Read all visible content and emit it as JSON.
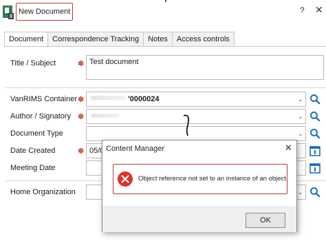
{
  "window": {
    "title": "New Document",
    "help_label": "?",
    "close_label": "✕"
  },
  "tabs": [
    {
      "label": "Document"
    },
    {
      "label": "Correspondence Tracking"
    },
    {
      "label": "Notes"
    },
    {
      "label": "Access controls"
    }
  ],
  "form": {
    "required_marker": "✽",
    "title_subject": {
      "label": "Title / Subject",
      "value": "Test document"
    },
    "container": {
      "label": "VanRIMS Container",
      "value": "'0000024"
    },
    "author": {
      "label": "Author / Signatory",
      "value": ""
    },
    "doc_type": {
      "label": "Document Type",
      "value": ""
    },
    "date_created": {
      "label": "Date Created",
      "value": "05/0"
    },
    "meeting_date": {
      "label": "Meeting Date",
      "value": ""
    },
    "home_org": {
      "label": "Home Organization",
      "value": ""
    }
  },
  "dialog": {
    "title": "Content Manager",
    "close_label": "✕",
    "message": "Object reference not set to an instance of an object.",
    "ok_label": "OK"
  },
  "colors": {
    "highlight_border": "#b03a3a",
    "error_red": "#d9342b",
    "required_red": "#c0392b",
    "search_blue": "#1f6fb5"
  }
}
